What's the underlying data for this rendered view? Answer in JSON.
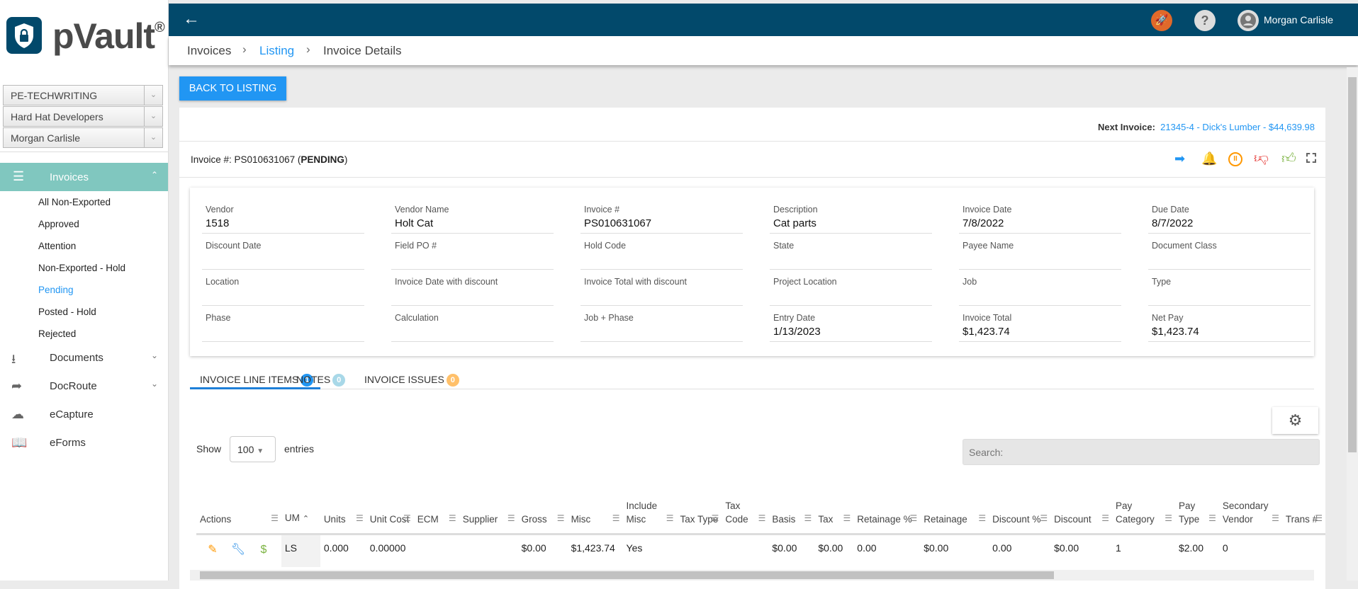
{
  "app": {
    "name": "pVault",
    "reg": "®"
  },
  "selectors": [
    "PE-TECHWRITING",
    "Hard Hat Developers",
    "Morgan Carlisle"
  ],
  "nav": {
    "invoices": "Invoices",
    "sub": [
      "All Non-Exported",
      "Approved",
      "Attention",
      "Non-Exported - Hold",
      "Pending",
      "Posted - Hold",
      "Rejected"
    ],
    "active_sub": "Pending",
    "items": [
      {
        "label": "Documents",
        "icon": "download-icon",
        "chev": true
      },
      {
        "label": "DocRoute",
        "icon": "share-icon",
        "chev": true
      },
      {
        "label": "eCapture",
        "icon": "cloud-upload-icon",
        "chev": false
      },
      {
        "label": "eForms",
        "icon": "book-icon",
        "chev": false
      }
    ]
  },
  "topbar": {
    "user": "Morgan Carlisle"
  },
  "breadcrumb": [
    "Invoices",
    "Listing",
    "Invoice Details"
  ],
  "back_label": "BACK TO LISTING",
  "next_invoice": {
    "label": "Next Invoice:",
    "value": "21345-4 - Dick's Lumber - $44,639.98"
  },
  "invoice": {
    "prefix": "Invoice #: PS010631067 (",
    "status": "PENDING",
    "suffix": ")"
  },
  "fields": [
    {
      "label": "Vendor",
      "value": "1518"
    },
    {
      "label": "Vendor Name",
      "value": "Holt Cat"
    },
    {
      "label": "Invoice #",
      "value": "PS010631067"
    },
    {
      "label": "Description",
      "value": "Cat parts"
    },
    {
      "label": "Invoice Date",
      "value": "7/8/2022"
    },
    {
      "label": "Due Date",
      "value": "8/7/2022"
    },
    {
      "label": "Discount Date",
      "value": ""
    },
    {
      "label": "Field PO #",
      "value": ""
    },
    {
      "label": "Hold Code",
      "value": ""
    },
    {
      "label": "State",
      "value": ""
    },
    {
      "label": "Payee Name",
      "value": ""
    },
    {
      "label": "Document Class",
      "value": ""
    },
    {
      "label": "Location",
      "value": ""
    },
    {
      "label": "Invoice Date with discount",
      "value": ""
    },
    {
      "label": "Invoice Total with discount",
      "value": ""
    },
    {
      "label": "Project Location",
      "value": ""
    },
    {
      "label": "Job",
      "value": ""
    },
    {
      "label": "Type",
      "value": ""
    },
    {
      "label": "Phase",
      "value": ""
    },
    {
      "label": "Calculation",
      "value": ""
    },
    {
      "label": "Job + Phase",
      "value": ""
    },
    {
      "label": "Entry Date",
      "value": "1/13/2023"
    },
    {
      "label": "Invoice Total",
      "value": "$1,423.74"
    },
    {
      "label": "Net Pay",
      "value": "$1,423.74"
    }
  ],
  "tabs": [
    {
      "label": "INVOICE LINE ITEMS",
      "count": "1",
      "color": "#2196f3"
    },
    {
      "label": "NOTES",
      "count": "0",
      "color": "#a8d8e8"
    },
    {
      "label": "INVOICE ISSUES",
      "count": "0",
      "color": "#ffc06a"
    }
  ],
  "table_controls": {
    "show": "Show",
    "entries": "entries",
    "page_size": "100",
    "search_placeholder": "Search:"
  },
  "columns": [
    "Actions",
    "UM",
    "Units",
    "Unit Cost",
    "ECM",
    "Supplier",
    "Gross",
    "Misc",
    "Include Misc",
    "Tax Type",
    "Tax Code",
    "Basis",
    "Tax",
    "Retainage %",
    "Retainage",
    "Discount %",
    "Discount",
    "Pay Category",
    "Pay Type",
    "Secondary Vendor",
    "Trans #"
  ],
  "rows": [
    [
      "",
      "LS",
      "0.000",
      "0.00000",
      "",
      "",
      "$0.00",
      "$1,423.74",
      "Yes",
      "",
      "",
      "$0.00",
      "$0.00",
      "0.00",
      "$0.00",
      "0.00",
      "$0.00",
      "1",
      "$2.00",
      "0",
      ""
    ]
  ],
  "colors": {
    "header": "#02496b",
    "accent": "#2196f3",
    "nav_active": "#80c7bf"
  }
}
